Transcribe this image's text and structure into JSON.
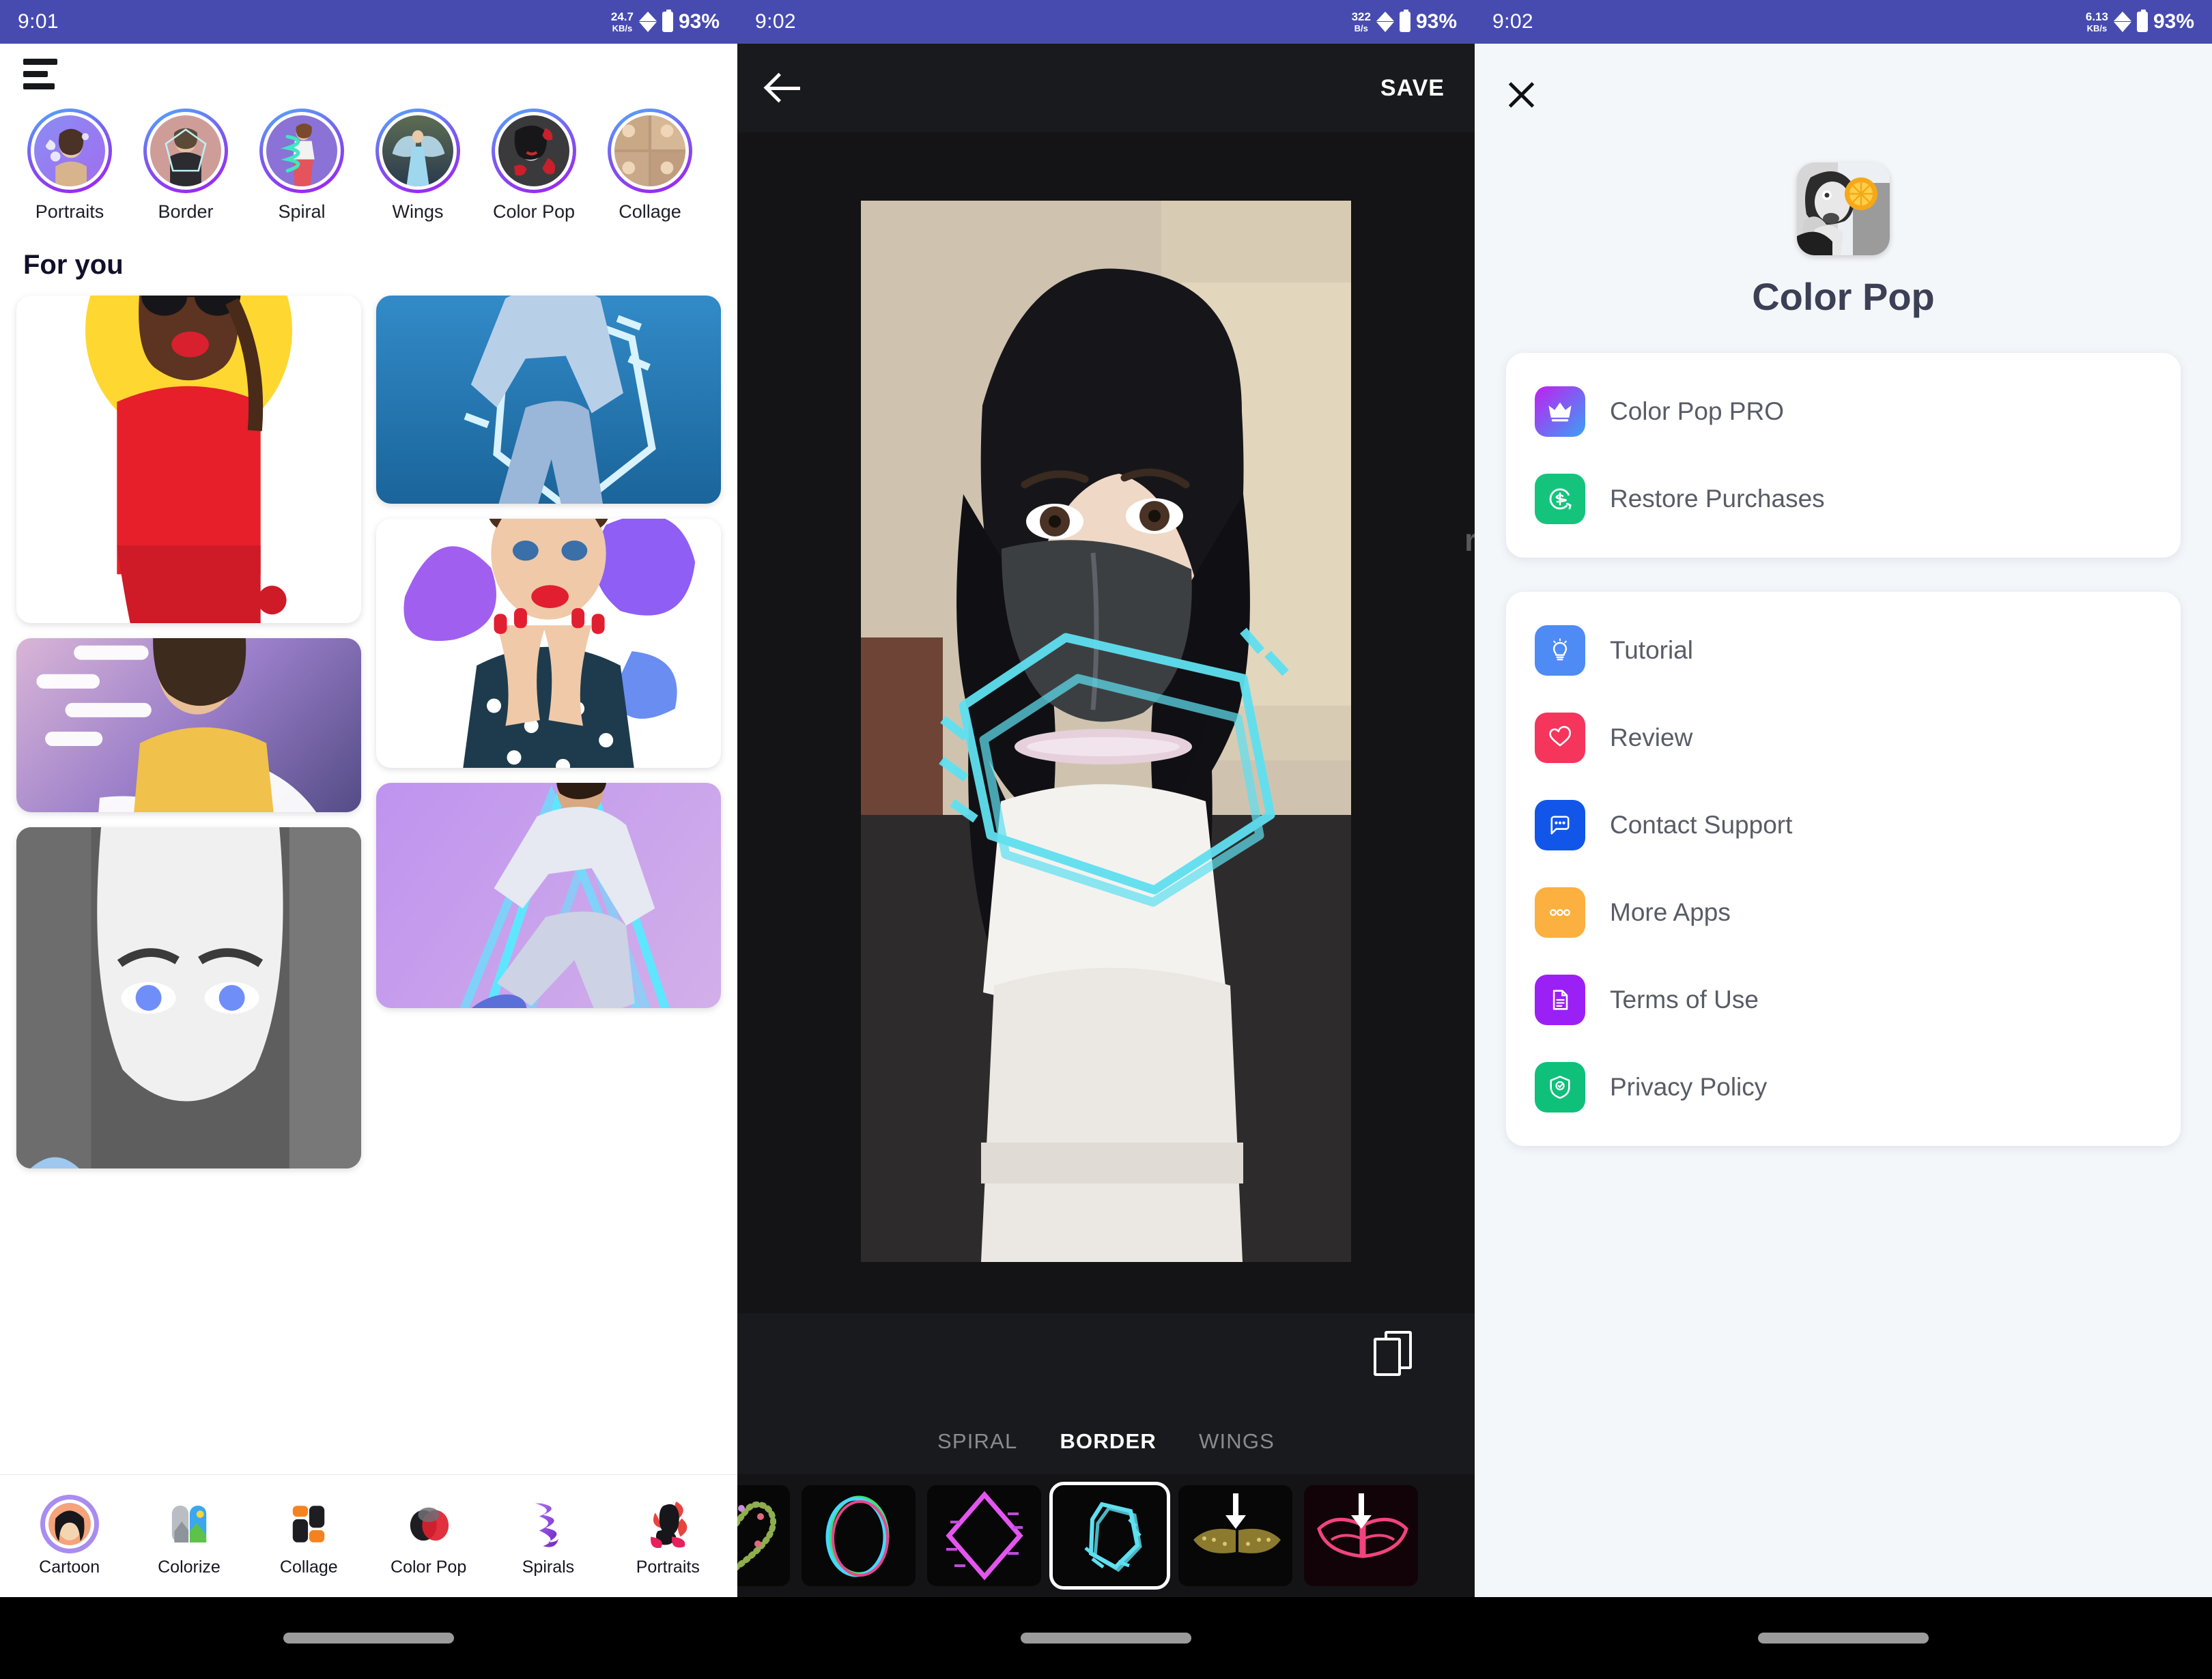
{
  "panels": {
    "home": {
      "status": {
        "time": "9:01",
        "net_rate": "24.7",
        "net_unit": "KB/s",
        "battery": "93%"
      },
      "menu_icon": "hamburger-menu-icon",
      "categories": [
        {
          "label": "Portraits"
        },
        {
          "label": "Border"
        },
        {
          "label": "Spiral"
        },
        {
          "label": "Wings"
        },
        {
          "label": "Color Pop"
        },
        {
          "label": "Collage"
        }
      ],
      "section_title": "For you",
      "bottom_nav": [
        {
          "label": "Cartoon",
          "icon": "cartoon-icon",
          "selected": true
        },
        {
          "label": "Colorize",
          "icon": "colorize-icon",
          "selected": false
        },
        {
          "label": "Collage",
          "icon": "collage-icon",
          "selected": false
        },
        {
          "label": "Color Pop",
          "icon": "color-pop-icon",
          "selected": false
        },
        {
          "label": "Spirals",
          "icon": "spirals-icon",
          "selected": false
        },
        {
          "label": "Portraits",
          "icon": "portraits-icon",
          "selected": false
        }
      ]
    },
    "editor": {
      "status": {
        "time": "9:02",
        "net_rate": "322",
        "net_unit": "B/s",
        "battery": "93%"
      },
      "back_icon": "back-arrow-icon",
      "save_label": "SAVE",
      "watermark": "rjshe",
      "layers_icon": "layers-icon",
      "tabs": [
        {
          "label": "SPIRAL",
          "active": false
        },
        {
          "label": "BORDER",
          "active": true
        },
        {
          "label": "WINGS",
          "active": false
        }
      ],
      "effects": [
        {
          "name": "flower-heart-effect",
          "selected": false,
          "download": false
        },
        {
          "name": "neon-circle-effect",
          "selected": false,
          "download": false
        },
        {
          "name": "neon-diamond-effect",
          "selected": false,
          "download": false
        },
        {
          "name": "neon-pentagon-effect",
          "selected": true,
          "download": false
        },
        {
          "name": "gold-wings-effect",
          "selected": false,
          "download": true
        },
        {
          "name": "pink-wings-effect",
          "selected": false,
          "download": true
        }
      ]
    },
    "settings": {
      "status": {
        "time": "9:02",
        "net_rate": "6.13",
        "net_unit": "KB/s",
        "battery": "93%"
      },
      "close_icon": "close-icon",
      "app_icon": "color-pop-app-icon",
      "app_title": "Color Pop",
      "purchase_items": [
        {
          "label": "Color Pop PRO",
          "icon": "crown-icon",
          "color": "#8e35f0"
        },
        {
          "label": "Restore Purchases",
          "icon": "restore-dollar-icon",
          "color": "#14c47d"
        }
      ],
      "menu_items": [
        {
          "label": "Tutorial",
          "icon": "lightbulb-icon",
          "color": "#4f8bf5"
        },
        {
          "label": "Review",
          "icon": "heart-icon",
          "color": "#f5355c"
        },
        {
          "label": "Contact Support",
          "icon": "chat-bubble-icon",
          "color": "#1156e8"
        },
        {
          "label": "More Apps",
          "icon": "three-dots-icon",
          "color": "#fbb040"
        },
        {
          "label": "Terms of Use",
          "icon": "document-icon",
          "color": "#9b20f5"
        },
        {
          "label": "Privacy Policy",
          "icon": "shield-check-icon",
          "color": "#0fc07a"
        }
      ]
    }
  },
  "theme": {
    "statusbar_bg": "#474bb0",
    "editor_bg": "#191a1d",
    "settings_bg": "#f4f7fa",
    "accent": "#8e35f0"
  }
}
